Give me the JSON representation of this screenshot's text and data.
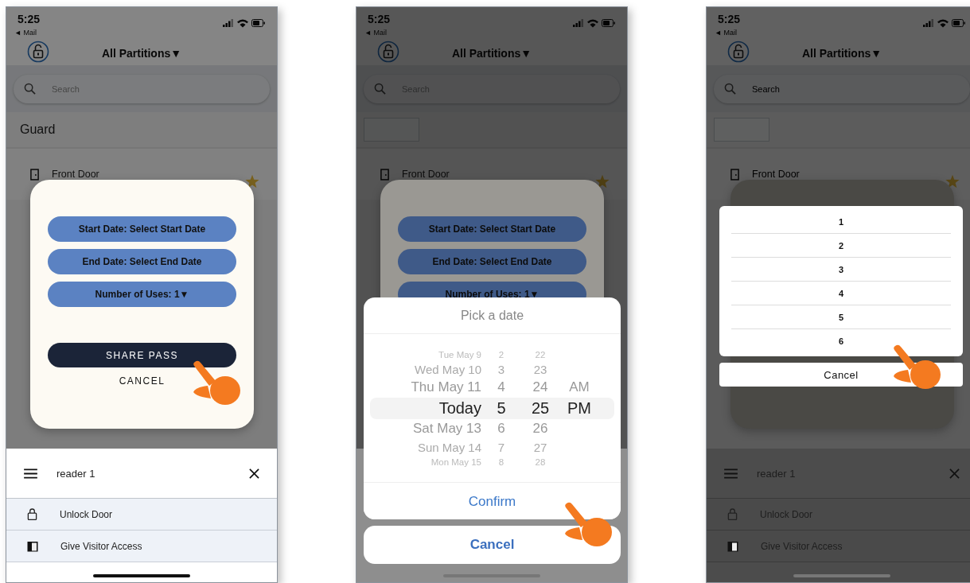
{
  "phones": [
    {
      "status": {
        "time": "5:25",
        "back": "◄ Mail"
      },
      "title": "All Partitions▼",
      "search": {
        "placeholder": "Search"
      },
      "section": {
        "title": "Guard"
      },
      "door": {
        "name": "Front Door",
        "favorite": true
      },
      "modal": {
        "dimmed": false,
        "buttons": [
          {
            "label": "Start Date: Select Start Date",
            "kind": "pill"
          },
          {
            "label": "End Date: Select End Date",
            "kind": "pill"
          },
          {
            "label": "Number of Uses: 1▼",
            "kind": "pill"
          },
          {
            "label": "SHARE PASS",
            "kind": "primary"
          },
          {
            "label": "CANCEL",
            "kind": "text"
          }
        ]
      },
      "sheet": {
        "dimmed": false,
        "title": "reader 1",
        "items": [
          {
            "label": "Unlock Door",
            "kind": "lock"
          },
          {
            "label": "Give Visitor Access",
            "kind": "visitor"
          }
        ]
      }
    },
    {
      "status": {
        "time": "5:25",
        "back": "◄ Mail"
      },
      "title": "All Partitions▼",
      "search": {
        "placeholder": "Search"
      },
      "door": {
        "name": "Front Door",
        "favorite": true
      },
      "modal": {
        "dimmed": true,
        "buttons": [
          {
            "label": "Start Date: Select Start Date",
            "kind": "pill"
          },
          {
            "label": "End Date: Select End Date",
            "kind": "pill"
          },
          {
            "label": "Number of Uses: 1▼",
            "kind": "pill"
          }
        ]
      },
      "sheet": {
        "dimmed": true
      },
      "picker": {
        "kind": "date",
        "title": "Pick a date",
        "rows": [
          {
            "date": "Tue May 9",
            "hour": "2",
            "minute": "22",
            "selected": false
          },
          {
            "date": "Wed May 10",
            "hour": "3",
            "minute": "23",
            "selected": false
          },
          {
            "date": "Thu May 11",
            "hour": "4",
            "minute": "24",
            "ampm": "AM",
            "selected": false
          },
          {
            "date": "Today",
            "hour": "5",
            "minute": "25",
            "ampm": "PM",
            "selected": true
          },
          {
            "date": "Sat May 13",
            "hour": "6",
            "minute": "26",
            "selected": false
          },
          {
            "date": "Sun May 14",
            "hour": "7",
            "minute": "27",
            "selected": false
          },
          {
            "date": "Mon May 15",
            "hour": "8",
            "minute": "28",
            "selected": false
          }
        ],
        "confirm": "Confirm",
        "cancel": "Cancel"
      }
    },
    {
      "status": {
        "time": "5:25",
        "back": "◄ Mail"
      },
      "title": "All Partitions▼",
      "search": {
        "placeholder": "Search"
      },
      "door": {
        "name": "Front Door",
        "favorite": true
      },
      "modal": {
        "dimmed": true
      },
      "sheet": {
        "dimmed": true,
        "title": "reader 1",
        "items": [
          {
            "label": "Unlock Door",
            "kind": "lock"
          },
          {
            "label": "Give Visitor Access",
            "kind": "visitor"
          }
        ]
      },
      "picker": {
        "kind": "list",
        "options": [
          {
            "label": "1"
          },
          {
            "label": "2"
          },
          {
            "label": "3"
          },
          {
            "label": "4"
          },
          {
            "label": "5"
          },
          {
            "label": "6"
          }
        ],
        "cancel": "Cancel"
      }
    }
  ]
}
